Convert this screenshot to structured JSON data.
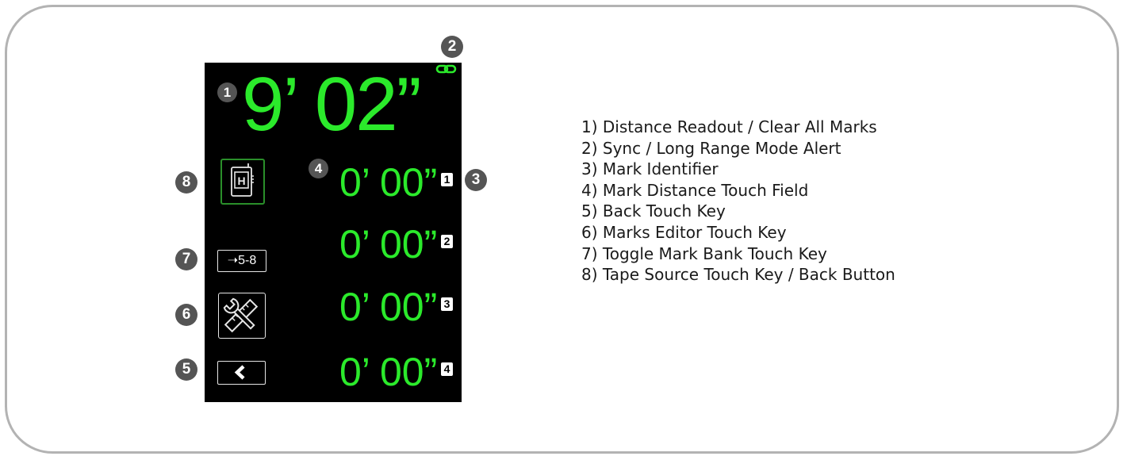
{
  "readout": {
    "value": "9’ 02”"
  },
  "marks": [
    {
      "value": "0’ 00”",
      "id": "1"
    },
    {
      "value": "0’ 00”",
      "id": "2"
    },
    {
      "value": "0’ 00”",
      "id": "3"
    },
    {
      "value": "0’ 00”",
      "id": "4"
    }
  ],
  "keys": {
    "bank_label": "➝5-8",
    "tape_letter": "H"
  },
  "badges": [
    "1",
    "2",
    "3",
    "4",
    "5",
    "6",
    "7",
    "8"
  ],
  "legend": [
    "1) Distance Readout / Clear All Marks",
    "2) Sync / Long Range Mode Alert",
    "3) Mark Identifier",
    "4) Mark Distance Touch Field",
    "5) Back Touch Key",
    "6) Marks Editor Touch Key",
    "7) Toggle Mark Bank Touch Key",
    "8) Tape Source Touch Key / Back Button"
  ],
  "icons": {
    "sync": "link-icon",
    "tape": "tape-device-icon",
    "bank": "arrow-right-icon",
    "editor": "wrench-ruler-icon",
    "back": "chevron-left-icon"
  },
  "colors": {
    "readout": "#2bea2b",
    "screen": "#000000",
    "badge": "#555555",
    "frame": "#b3b3b3"
  }
}
